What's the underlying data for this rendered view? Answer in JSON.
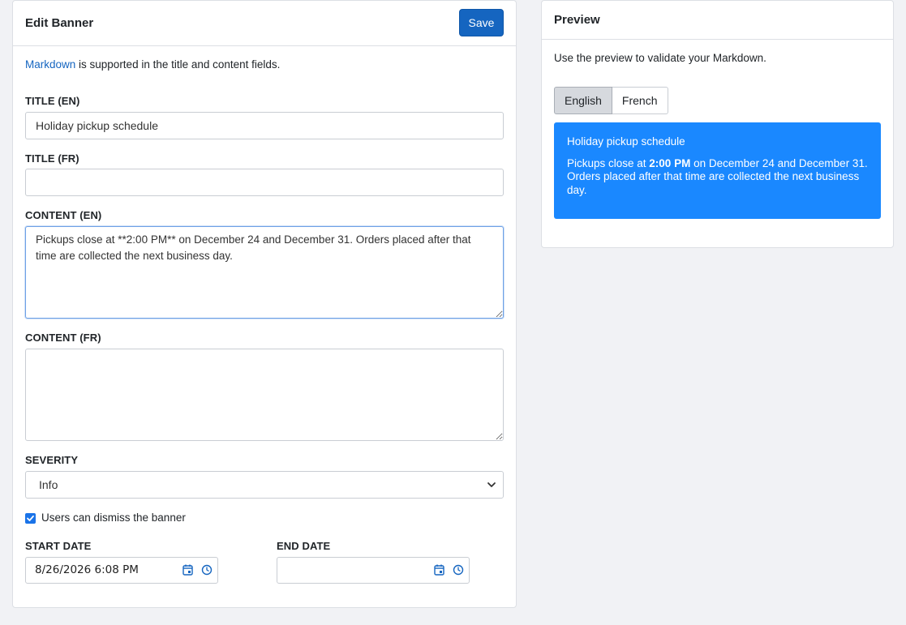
{
  "edit_card": {
    "title": "Edit Banner",
    "save_label": "Save",
    "help_link": "Markdown",
    "help_rest": " is supported in the title and content fields.",
    "title_en": {
      "label": "TITLE (EN)",
      "value": "Holiday pickup schedule"
    },
    "title_fr": {
      "label": "TITLE (FR)",
      "value": ""
    },
    "content_en": {
      "label": "CONTENT (EN)",
      "value": "Pickups close at **2:00 PM** on December 24 and December 31. Orders placed after that time are collected the next business day."
    },
    "content_fr": {
      "label": "CONTENT (FR)",
      "value": ""
    },
    "severity": {
      "label": "SEVERITY",
      "selected": "Info"
    },
    "dismiss": {
      "label": "Users can dismiss the banner",
      "checked": true
    },
    "start_date": {
      "label": "START DATE",
      "value": "8/26/2026 6:08 PM"
    },
    "end_date": {
      "label": "END DATE",
      "value": ""
    }
  },
  "preview_card": {
    "title": "Preview",
    "help": "Use the preview to validate your Markdown.",
    "languages": [
      "English",
      "French"
    ],
    "active_language": "English",
    "banner": {
      "title": "Holiday pickup schedule",
      "body_pre": "Pickups close at ",
      "body_bold": "2:00 PM",
      "body_post": " on December 24 and December 31. Orders placed after that time are collected the next business day."
    }
  },
  "colors": {
    "accent": "#1565c0",
    "banner_info": "#1a88ff",
    "page_bg": "#f1f2f5"
  },
  "icons": [
    "calendar-icon",
    "clock-icon",
    "chevron-down-icon",
    "checkmark-icon"
  ]
}
